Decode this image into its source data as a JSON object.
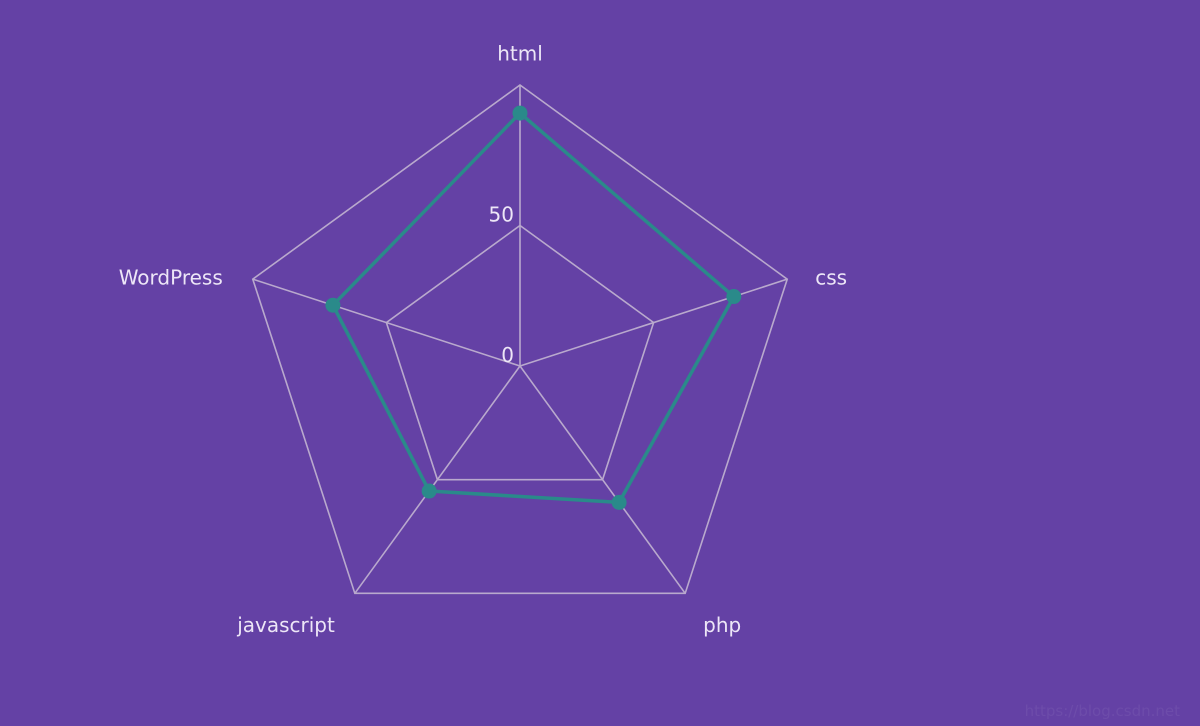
{
  "colors": {
    "background": "#6441a5",
    "grid": "#b9a9cd",
    "series": "#2a8a8a",
    "text": "#ede6f7"
  },
  "watermark": "https://blog.csdn.net",
  "chart_data": {
    "type": "radar",
    "categories": [
      "html",
      "css",
      "php",
      "javascript",
      "WordPress"
    ],
    "series": [
      {
        "values": [
          90,
          80,
          60,
          55,
          70
        ]
      }
    ],
    "radial_ticks": [
      "0",
      "50"
    ],
    "rlim": [
      0,
      100
    ],
    "grid": true
  }
}
